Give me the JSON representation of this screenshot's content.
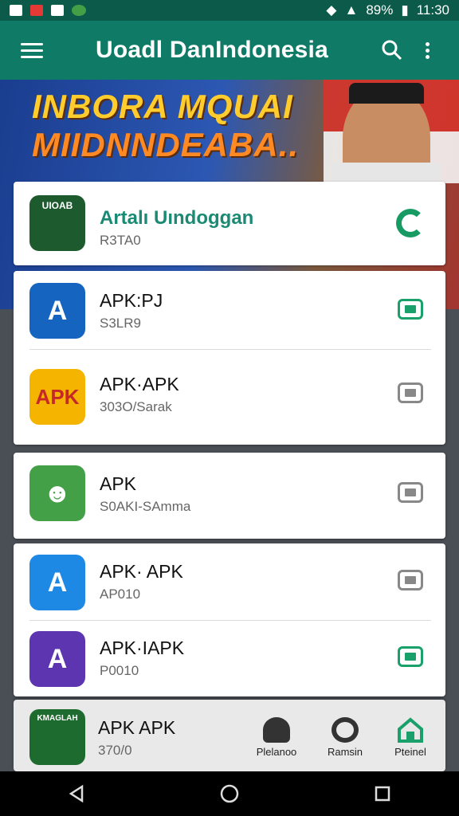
{
  "status": {
    "battery": "89%",
    "time": "11:30"
  },
  "appbar": {
    "title": "Uoadl DanIndonesia"
  },
  "banner": {
    "line1": "INBORA MQUAI",
    "line2": "MIIDNNDEABA.."
  },
  "featured": {
    "name": "Artalı Uındoggan",
    "sub": "R3TA0",
    "icon_text": "UIOAB"
  },
  "apps": [
    {
      "name": "APK:PJ",
      "sub": "S3LR9",
      "icon_text": "A",
      "checked": true,
      "color": "#1565c0"
    },
    {
      "name": "APK·APK",
      "sub": "303O/Sarak",
      "icon_text": "APK",
      "checked": false,
      "color": "#f4b400"
    },
    {
      "name": "APK",
      "sub": "S0AKI-SAmma",
      "icon_text": "☻",
      "checked": false,
      "color": "#43a047"
    },
    {
      "name": "APK· APK",
      "sub": "AP010",
      "icon_text": "A",
      "checked": false,
      "color": "#1e88e5"
    },
    {
      "name": "APK·IAPK",
      "sub": "P0010",
      "icon_text": "A",
      "checked": true,
      "color": "#5e35b1"
    }
  ],
  "bottom": {
    "name": "APK APK",
    "sub": "370/0",
    "icon_text": "KMAGLAH",
    "nav": [
      {
        "label": "Plelanoo",
        "icon": "hand-icon"
      },
      {
        "label": "Ramsin",
        "icon": "circle-icon"
      },
      {
        "label": "Pteinel",
        "icon": "home-icon"
      }
    ]
  },
  "colors": {
    "primary": "#0f7a65",
    "accent": "#1aa06a"
  }
}
